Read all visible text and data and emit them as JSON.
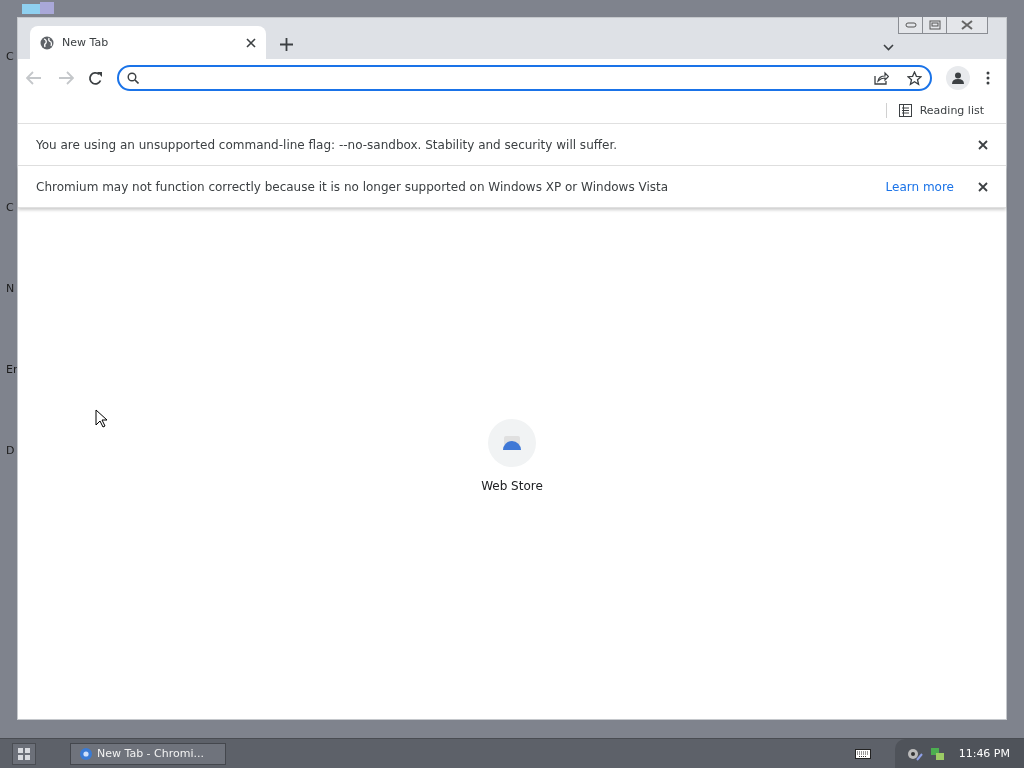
{
  "desktop": {
    "icon_labels": [
      "C",
      "C",
      "N",
      "Er",
      "D"
    ]
  },
  "browser": {
    "tabs": [
      {
        "title": "New Tab",
        "selected": true
      }
    ],
    "bookmarks_bar": {
      "reading_list": "Reading list"
    },
    "infobars": [
      {
        "message": "You are using an unsupported command-line flag: --no-sandbox. Stability and security will suffer."
      },
      {
        "message": "Chromium may not function correctly because it is no longer supported on Windows XP or Windows Vista",
        "link": "Learn more"
      }
    ],
    "shortcuts": [
      {
        "title": "Web Store"
      }
    ]
  },
  "taskbar": {
    "tasks": [
      {
        "title": "New Tab - Chromi...",
        "selected": true
      }
    ],
    "clock": "11:46 PM"
  }
}
